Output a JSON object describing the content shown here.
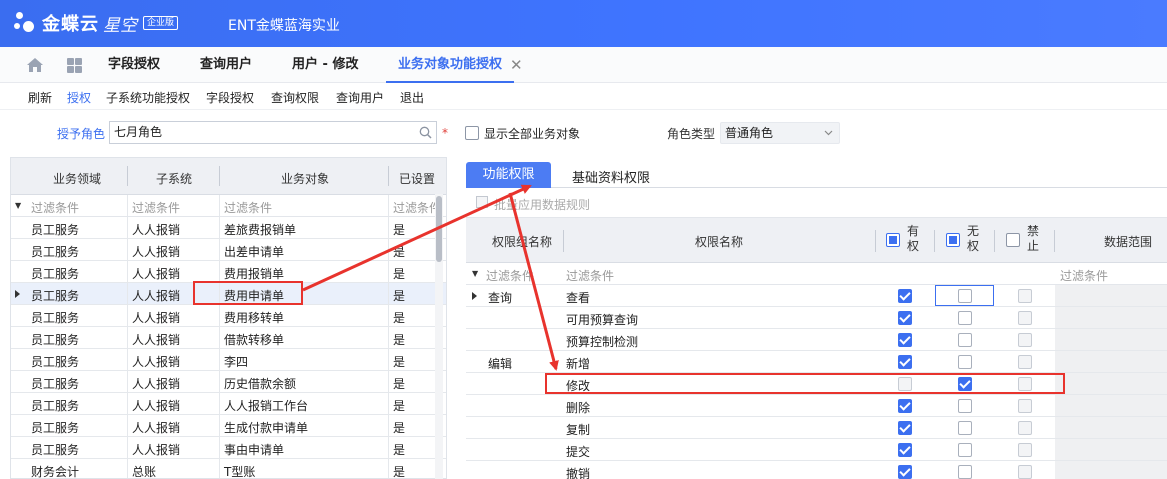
{
  "header": {
    "logo_name": "金蝶云",
    "logo_sub": "星空",
    "logo_badge": "企业版",
    "company": "ENT金蝶蓝海实业"
  },
  "tabs": [
    {
      "label": "字段授权"
    },
    {
      "label": "查询用户"
    },
    {
      "label": "用户 - 修改"
    },
    {
      "label": "业务对象功能授权",
      "active": true
    }
  ],
  "toolbar": [
    "刷新",
    "授权",
    "子系统功能授权",
    "字段授权",
    "查询权限",
    "查询用户",
    "退出"
  ],
  "filter": {
    "role_label": "授予角色",
    "role_value": "七月角色",
    "required_mark": "*",
    "show_all_label": "显示全部业务对象",
    "role_type_label": "角色类型",
    "role_type_value": "普通角色"
  },
  "left_table": {
    "columns": [
      "业务领域",
      "子系统",
      "业务对象",
      "已设置"
    ],
    "filter_text": "过滤条件",
    "rows": [
      [
        "员工服务",
        "人人报销",
        "差旅费报销单",
        "是"
      ],
      [
        "员工服务",
        "人人报销",
        "出差申请单",
        "是"
      ],
      [
        "员工服务",
        "人人报销",
        "费用报销单",
        "是"
      ],
      [
        "员工服务",
        "人人报销",
        "费用申请单",
        "是"
      ],
      [
        "员工服务",
        "人人报销",
        "费用移转单",
        "是"
      ],
      [
        "员工服务",
        "人人报销",
        "借款转移单",
        "是"
      ],
      [
        "员工服务",
        "人人报销",
        "李四",
        "是"
      ],
      [
        "员工服务",
        "人人报销",
        "历史借款余额",
        "是"
      ],
      [
        "员工服务",
        "人人报销",
        "人人报销工作台",
        "是"
      ],
      [
        "员工服务",
        "人人报销",
        "生成付款申请单",
        "是"
      ],
      [
        "员工服务",
        "人人报销",
        "事由申请单",
        "是"
      ],
      [
        "财务会计",
        "总账",
        "T型账",
        "是"
      ]
    ],
    "selected_row": 3
  },
  "right_panel": {
    "tabs": [
      "功能权限",
      "基础资料权限"
    ],
    "apply_rule_label": "批量应用数据规则",
    "columns": {
      "group": "权限组名称",
      "name": "权限名称",
      "has": "有权",
      "none": "无权",
      "forbid": "禁止",
      "scope": "数据范围"
    },
    "filter_text": "过滤条件",
    "rows": [
      {
        "group": "查询",
        "name": "查看",
        "has": true,
        "none": false,
        "forbid": false
      },
      {
        "group": "",
        "name": "可用预算查询",
        "has": true,
        "none": false,
        "forbid": false
      },
      {
        "group": "",
        "name": "预算控制检测",
        "has": true,
        "none": false,
        "forbid": false
      },
      {
        "group": "编辑",
        "name": "新增",
        "has": true,
        "none": false,
        "forbid": false
      },
      {
        "group": "",
        "name": "修改",
        "has": false,
        "none": true,
        "forbid": false
      },
      {
        "group": "",
        "name": "删除",
        "has": true,
        "none": false,
        "forbid": false
      },
      {
        "group": "",
        "name": "复制",
        "has": true,
        "none": false,
        "forbid": false
      },
      {
        "group": "",
        "name": "提交",
        "has": true,
        "none": false,
        "forbid": false
      },
      {
        "group": "",
        "name": "撤销",
        "has": true,
        "none": false,
        "forbid": false
      }
    ]
  },
  "colors": {
    "accent": "#3c6ff0",
    "annotation": "#e8332d"
  }
}
